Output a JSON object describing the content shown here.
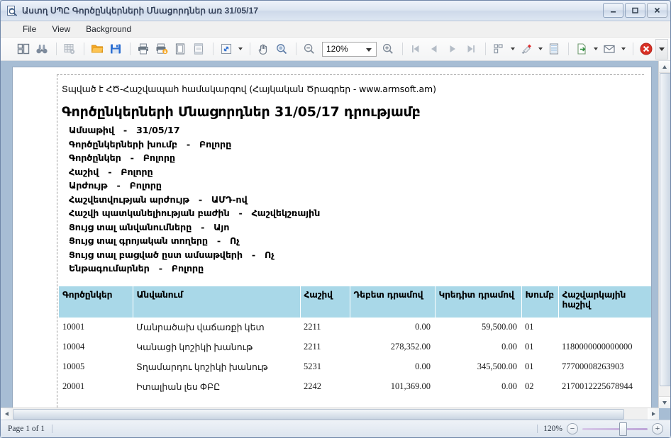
{
  "window": {
    "title": "Աստղ ՍՊԸ Գործընկերների Մնացորդներ առ 31/05/17",
    "icon": "report-preview-icon",
    "minimize_label": "–",
    "maximize_label": "□",
    "close_label": "✕"
  },
  "menubar": {
    "items": [
      {
        "label": "File"
      },
      {
        "label": "View"
      },
      {
        "label": "Background"
      }
    ]
  },
  "toolbar": {
    "zoom_value": "120%",
    "icons": [
      "thumbnails-panel-icon",
      "find-binoculars-icon",
      "grid-settings-icon",
      "open-folder-icon",
      "save-disk-icon",
      "print-icon",
      "quick-print-icon",
      "page-setup-icon",
      "header-footer-icon",
      "scale-icon",
      "hand-tool-icon",
      "magnifier-tool-icon",
      "zoom-out-icon",
      "zoom-in-icon",
      "first-page-icon",
      "previous-page-icon",
      "next-page-icon",
      "last-page-icon",
      "multiple-pages-icon",
      "page-color-icon",
      "watermark-icon",
      "export-document-icon",
      "send-via-email-icon",
      "close-preview-icon",
      "toolbar-overflow-icon"
    ]
  },
  "document": {
    "source_note": "Տպված է ՀԾ-Հաշվապահ համակարգով (Հայկական Ծրագրեր - www.armsoft.am)",
    "title": "Գործընկերների Մնացորդներ 31/05/17 դրությամբ",
    "parameters": [
      {
        "label": "Ամսաթիվ",
        "value": "31/05/17"
      },
      {
        "label": "Գործընկերների խումբ",
        "value": "Բոլորը"
      },
      {
        "label": "Գործընկեր",
        "value": "Բոլորը"
      },
      {
        "label": "Հաշիվ",
        "value": "Բոլորը"
      },
      {
        "label": "Արժույթ",
        "value": "Բոլորը"
      },
      {
        "label": "Հաշվետվության արժույթ",
        "value": "ԱՄԴ-ով"
      },
      {
        "label": "Հաշվի պատկանելիության բաժին",
        "value": "Հաշվեկշռային"
      },
      {
        "label": "Ցույց տալ անվանումները",
        "value": "Այո"
      },
      {
        "label": "Ցույց տալ գրոյական տողերը",
        "value": "Ոչ"
      },
      {
        "label": "Ցույց տալ բացված ըստ ամսաթվերի",
        "value": "Ոչ"
      },
      {
        "label": "Ենթագումարներ",
        "value": "Բոլորը"
      }
    ],
    "table": {
      "columns": [
        "Գործընկեր",
        "Անվանում",
        "Հաշիվ",
        "Դեբետ դրամով",
        "Կրեդիտ դրամով",
        "Խումբ",
        "Հաշվարկային հաշիվ"
      ],
      "rows": [
        {
          "partner": "10001",
          "name": "Մանրածախ վաճառքի կետ",
          "account": "2211",
          "debit": "0.00",
          "credit": "59,500.00",
          "group": "01",
          "settlement_account": ""
        },
        {
          "partner": "10004",
          "name": "Կանացի կոշիկի խանութ",
          "account": "2211",
          "debit": "278,352.00",
          "credit": "0.00",
          "group": "01",
          "settlement_account": "1180000000000000"
        },
        {
          "partner": "10005",
          "name": "Տղամարդու կոշիկի խանութ",
          "account": "5231",
          "debit": "0.00",
          "credit": "345,500.00",
          "group": "01",
          "settlement_account": "77700008263903"
        },
        {
          "partner": "20001",
          "name": "Իտալիան լես ՓԲԸ",
          "account": "2242",
          "debit": "101,369.00",
          "credit": "0.00",
          "group": "02",
          "settlement_account": "2170012225678944"
        }
      ]
    }
  },
  "statusbar": {
    "page_label": "Page 1 of 1",
    "zoom_label": "120%",
    "zoom_out_label": "−",
    "zoom_in_label": "+"
  },
  "colors": {
    "table_header_bg": "#a9d8e8",
    "title_bar": "#dce5f1",
    "viewer_bg": "#a7bdd4",
    "close_button": "#d93025"
  }
}
